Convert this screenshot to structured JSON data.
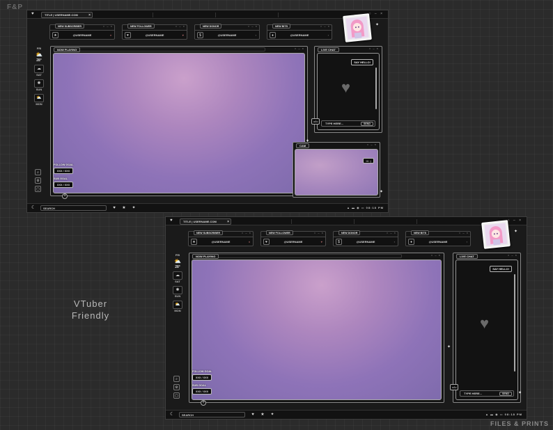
{
  "brand": "F&P",
  "credit": "FILES & PRINTS",
  "tagline": [
    "VTuber",
    "Friendly"
  ],
  "tab": {
    "title": "TITLE | USERNAME.COM",
    "close": "×"
  },
  "window_controls": "○ – ×",
  "alerts": [
    {
      "caption": "NEW SUBSCRIBER",
      "user": "@USERNAME",
      "icon": "★",
      "side": "♦"
    },
    {
      "caption": "NEW FOLLOWER",
      "user": "@USERNAME",
      "icon": "♥",
      "side": "♥"
    },
    {
      "caption": "NEW DONOR",
      "user": "@USERNAME",
      "icon": "$",
      "side": "›"
    },
    {
      "caption": "NEW BITS",
      "user": "@USERNAME",
      "icon": "♦",
      "side": "›"
    }
  ],
  "weather": {
    "today": "FRI",
    "temp": "28°",
    "days": [
      {
        "label": "SAT",
        "icon": "cloud-icon",
        "glyph": "☁"
      },
      {
        "label": "SUN",
        "icon": "sun-icon",
        "glyph": "✺"
      },
      {
        "label": "MON",
        "icon": "cloud-sun-icon",
        "glyph": "⛅"
      }
    ]
  },
  "now_playing": {
    "title": "NOW PLAYING"
  },
  "chat": {
    "title": "LIVE CHAT",
    "say_hello": "SAY HELLO!",
    "input_placeholder": "TYPE HERE...",
    "send": "SEND",
    "viewers": "o/lo"
  },
  "cam": {
    "title": "CAM",
    "hi": "HI :)"
  },
  "goals": {
    "follow_label": "FOLLOW GOAL",
    "follow_value": "XXX / XXX",
    "sub_label": "SUB GOAL",
    "sub_value": "XXX / XXX"
  },
  "taskbar": {
    "search": "SEARCH",
    "time": "08:18 PM",
    "status_icons": "▲ ▬ ◉ ▭"
  },
  "colors": {
    "view_light": "#caa0cb",
    "view_dark": "#7d6aab",
    "frame": "#1a1a1a",
    "bg": "#2b2b2b"
  }
}
